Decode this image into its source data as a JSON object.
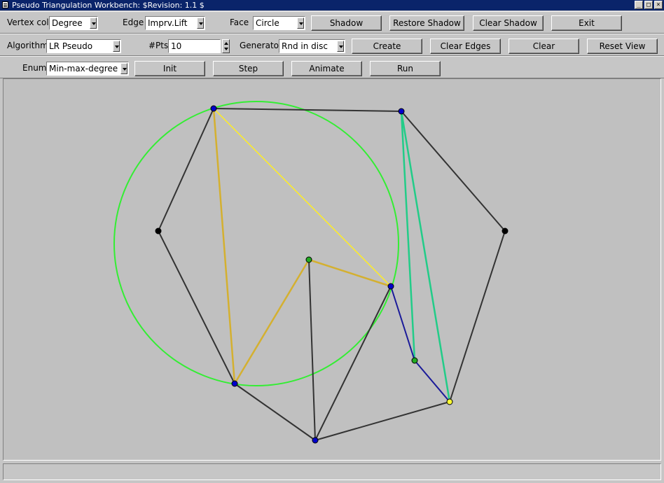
{
  "window": {
    "title": "Pseudo Triangulation Workbench: $Revision: 1.1 $",
    "minimize_glyph": "_",
    "maximize_glyph": "□",
    "close_glyph": "×"
  },
  "row1": {
    "vertex_col_label": "Vertex col",
    "vertex_col_value": "Degree",
    "edge_label": "Edge",
    "edge_value": "Imprv.Lift",
    "face_label": "Face",
    "face_value": "Circle",
    "shadow": "Shadow",
    "restore_shadow": "Restore Shadow",
    "clear_shadow": "Clear Shadow",
    "exit": "Exit"
  },
  "row2": {
    "algorithm_label": "Algorithm",
    "algorithm_value": "LR Pseudo",
    "npts_label": "#Pts",
    "npts_value": "10",
    "generator_label": "Generator",
    "generator_value": "Rnd in disc",
    "create": "Create",
    "clear_edges": "Clear Edges",
    "clear": "Clear",
    "reset_view": "Reset View"
  },
  "row3": {
    "enum_label": "Enum",
    "enum_value": "Min-max-degree",
    "init": "Init",
    "step": "Step",
    "animate": "Animate",
    "run": "Run"
  },
  "status": {
    "text": ""
  },
  "colors": {
    "vertex_blue": "#0000cc",
    "vertex_green": "#22aa22",
    "vertex_yellow": "#ffff33",
    "vertex_black": "#000000",
    "edge_dark": "#333333",
    "edge_gold": "#d4b030",
    "edge_yellow": "#ffee22",
    "edge_teal": "#22cc88",
    "edge_navy": "#1a1a99",
    "circle_green": "#33ee33"
  }
}
